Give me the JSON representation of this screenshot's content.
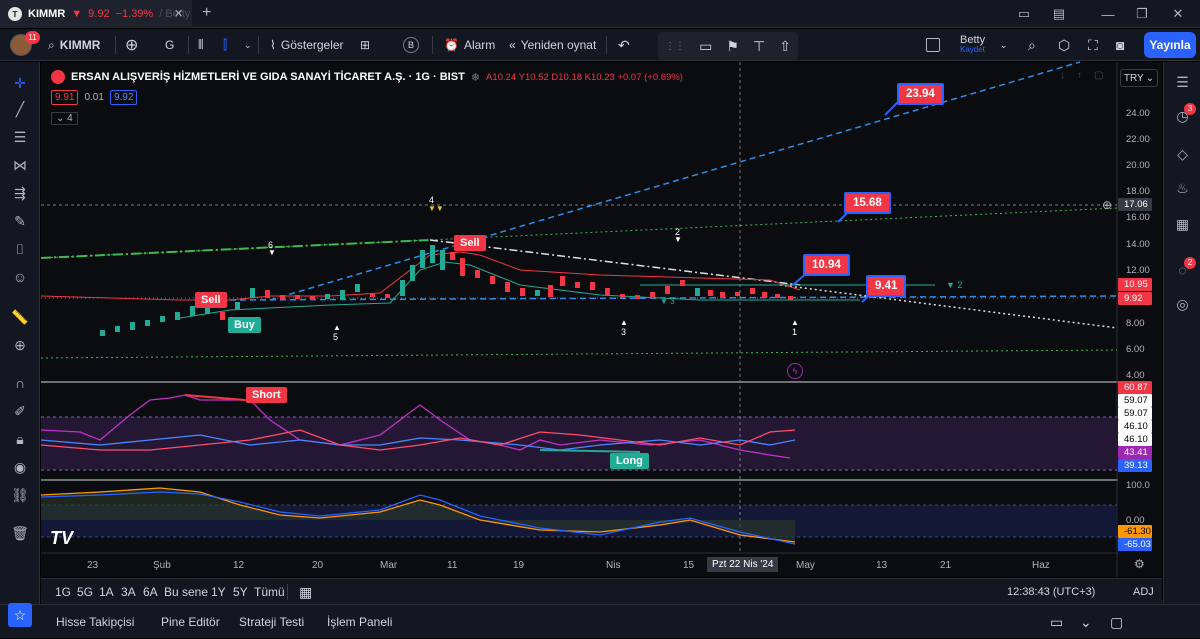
{
  "tab": {
    "symbol": "KIMMR",
    "price": "9.92",
    "change": "−1.39%",
    "faded": "/ Betty",
    "icon": "T"
  },
  "window": {
    "minimize": "—",
    "restore": "❐",
    "close": "✕",
    "new_tab": "+"
  },
  "toolbar": {
    "avatar_badge": "11",
    "symbol": "KIMMR",
    "interval": "G",
    "indicators": "Göstergeler",
    "alert": "Alarm",
    "replay": "Yeniden oynat",
    "layout_name": "Betty",
    "layout_sub": "Kaydet",
    "publish": "Yayınla"
  },
  "legend": {
    "name": "ERSAN ALIŞVERİŞ HİZMETLERİ VE GIDA SANAYİ TİCARET A.Ş. · 1G · BIST",
    "open": "A10.24",
    "high": "Y10.52",
    "low": "D10.18",
    "close": "K10.23",
    "change": "+0.07 (+0.69%)",
    "bid": "9.91",
    "spread": "0.01",
    "ask": "9.92",
    "collapse": "4"
  },
  "currency": "TRY",
  "price_axis": [
    "24.00",
    "22.00",
    "20.00",
    "18.00",
    "16.00",
    "14.00",
    "12.00",
    "8.00",
    "6.00",
    "4.00"
  ],
  "price_labels": {
    "crosshair": "17.06",
    "high": "10.95",
    "last": "9.92"
  },
  "osc_axis": {
    "a": "60.87",
    "b": "59.07",
    "c": "59.07",
    "d": "46.10",
    "e": "46.10",
    "f": "43.41",
    "g": "39.13"
  },
  "macd_axis": {
    "top": "100.0",
    "mid": "0.00",
    "v1": "-61.30",
    "v2": "-65.03"
  },
  "time_axis": [
    "23",
    "Şub",
    "12",
    "20",
    "Mar",
    "11",
    "19",
    "Nis",
    "15",
    "May",
    "13",
    "21",
    "Haz"
  ],
  "time_hover": "Pzt 22 Nis '24",
  "annotations": {
    "target1": "23.94",
    "target2": "15.68",
    "target3": "10.94",
    "target4": "9.41",
    "sell1": "Sell",
    "sell2": "Sell",
    "buy": "Buy",
    "short": "Short",
    "long": "Long",
    "n4": "4",
    "n6": "6",
    "n5": "5",
    "n3": "3",
    "n2": "2",
    "n1": "1",
    "n2b": "2",
    "n3b": "3"
  },
  "ranges": [
    "1G",
    "5G",
    "1A",
    "3A",
    "6A",
    "Bu sene",
    "1Y",
    "5Y",
    "Tümü"
  ],
  "clock": "12:38:43 (UTC+3)",
  "adj": "ADJ",
  "panels": [
    "Hisse Takipçisi",
    "Pine Editör",
    "Strateji Testi",
    "İşlem Paneli"
  ],
  "right_badges": {
    "alerts": "3",
    "notif": "2"
  },
  "colors": {
    "up": "#22ab94",
    "down": "#f23645",
    "accent": "#2962ff"
  }
}
